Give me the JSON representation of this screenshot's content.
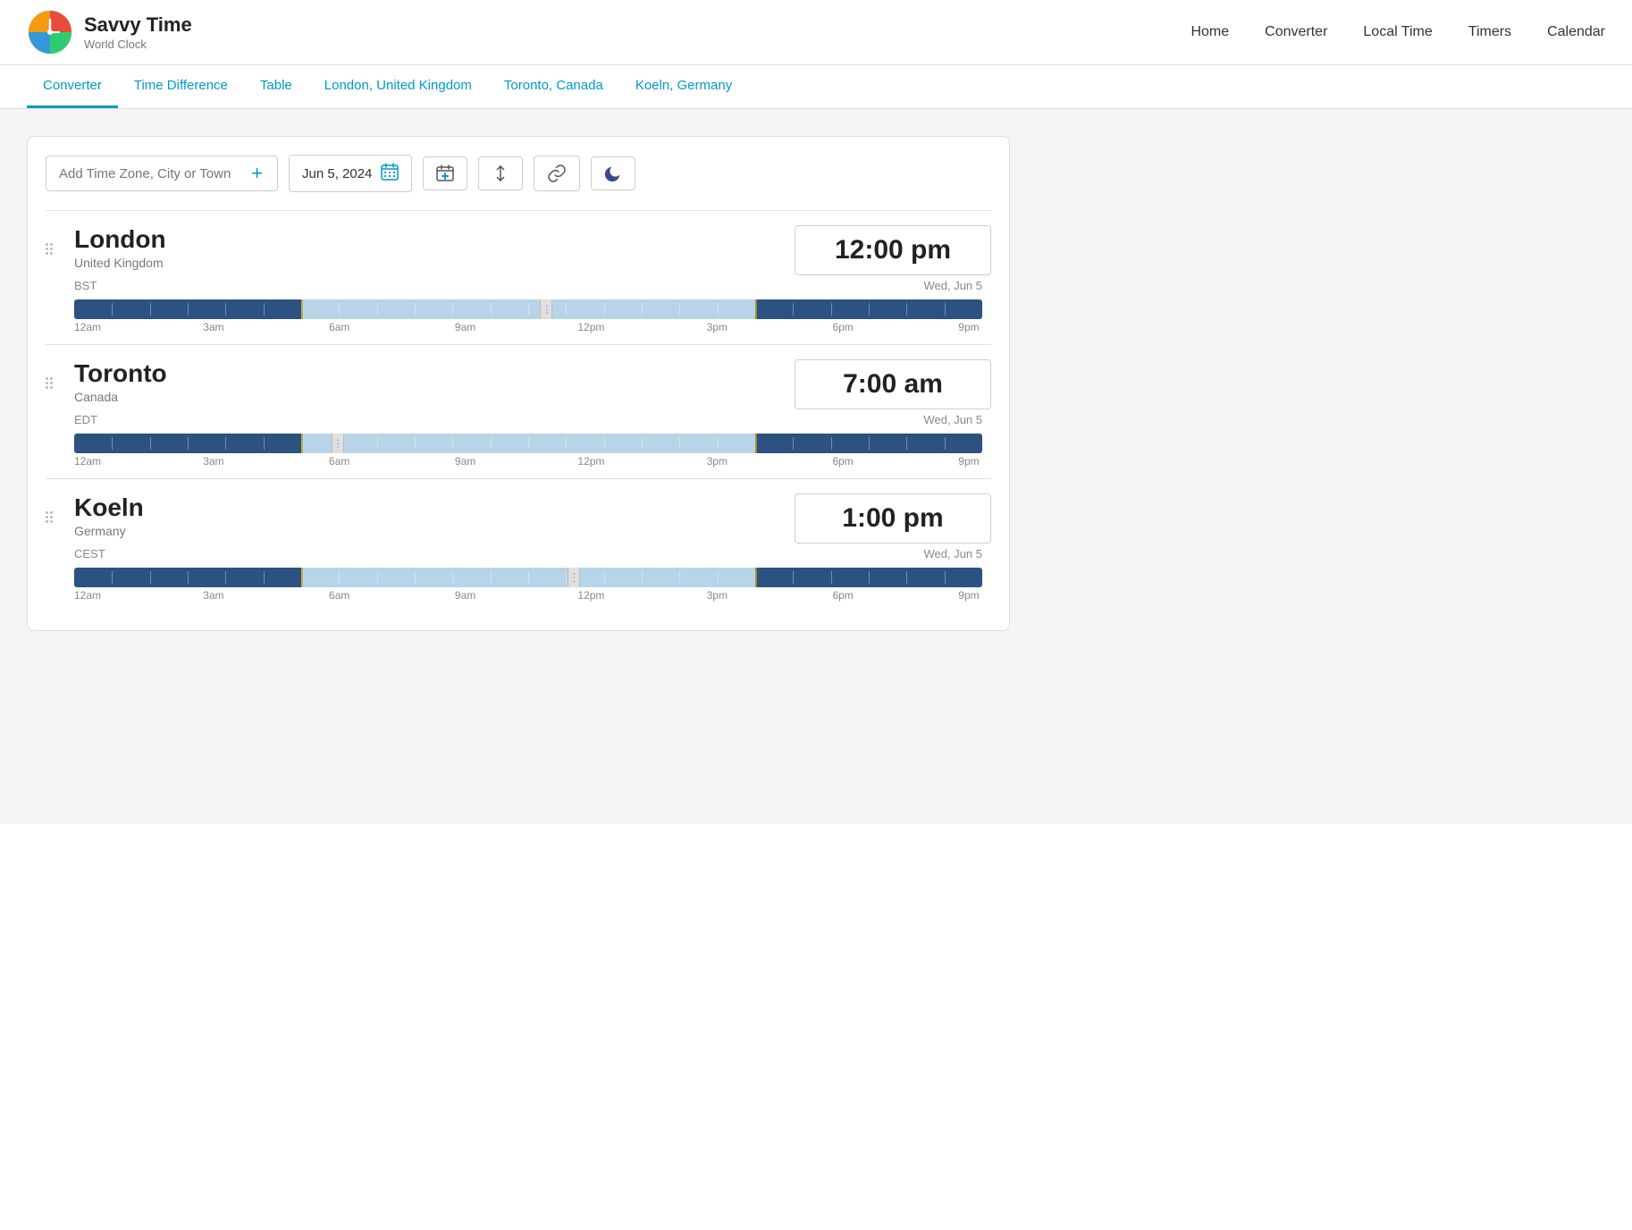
{
  "site": {
    "title": "Savvy Time",
    "subtitle": "World Clock"
  },
  "nav": {
    "items": [
      {
        "label": "Home",
        "href": "#"
      },
      {
        "label": "Converter",
        "href": "#"
      },
      {
        "label": "Local Time",
        "href": "#"
      },
      {
        "label": "Timers",
        "href": "#"
      },
      {
        "label": "Calendar",
        "href": "#"
      }
    ]
  },
  "subnav": {
    "items": [
      {
        "label": "Converter",
        "active": true
      },
      {
        "label": "Time Difference",
        "active": false
      },
      {
        "label": "Table",
        "active": false
      },
      {
        "label": "London, United Kingdom",
        "active": false
      },
      {
        "label": "Toronto, Canada",
        "active": false
      },
      {
        "label": "Koeln, Germany",
        "active": false
      }
    ]
  },
  "toolbar": {
    "search_placeholder": "Add Time Zone, City or Town",
    "date_value": "Jun 5, 2024"
  },
  "cities": [
    {
      "name": "London",
      "country": "United Kingdom",
      "time": "12:00 pm",
      "tz": "BST",
      "date": "Wed, Jun 5",
      "handle_pct": 52
    },
    {
      "name": "Toronto",
      "country": "Canada",
      "time": "7:00 am",
      "tz": "EDT",
      "date": "Wed, Jun 5",
      "handle_pct": 29
    },
    {
      "name": "Koeln",
      "country": "Germany",
      "time": "1:00 pm",
      "tz": "CEST",
      "date": "Wed, Jun 5",
      "handle_pct": 55
    }
  ],
  "timeline_labels": [
    "12am",
    "3am",
    "6am",
    "9am",
    "12pm",
    "3pm",
    "6pm",
    "9pm"
  ]
}
